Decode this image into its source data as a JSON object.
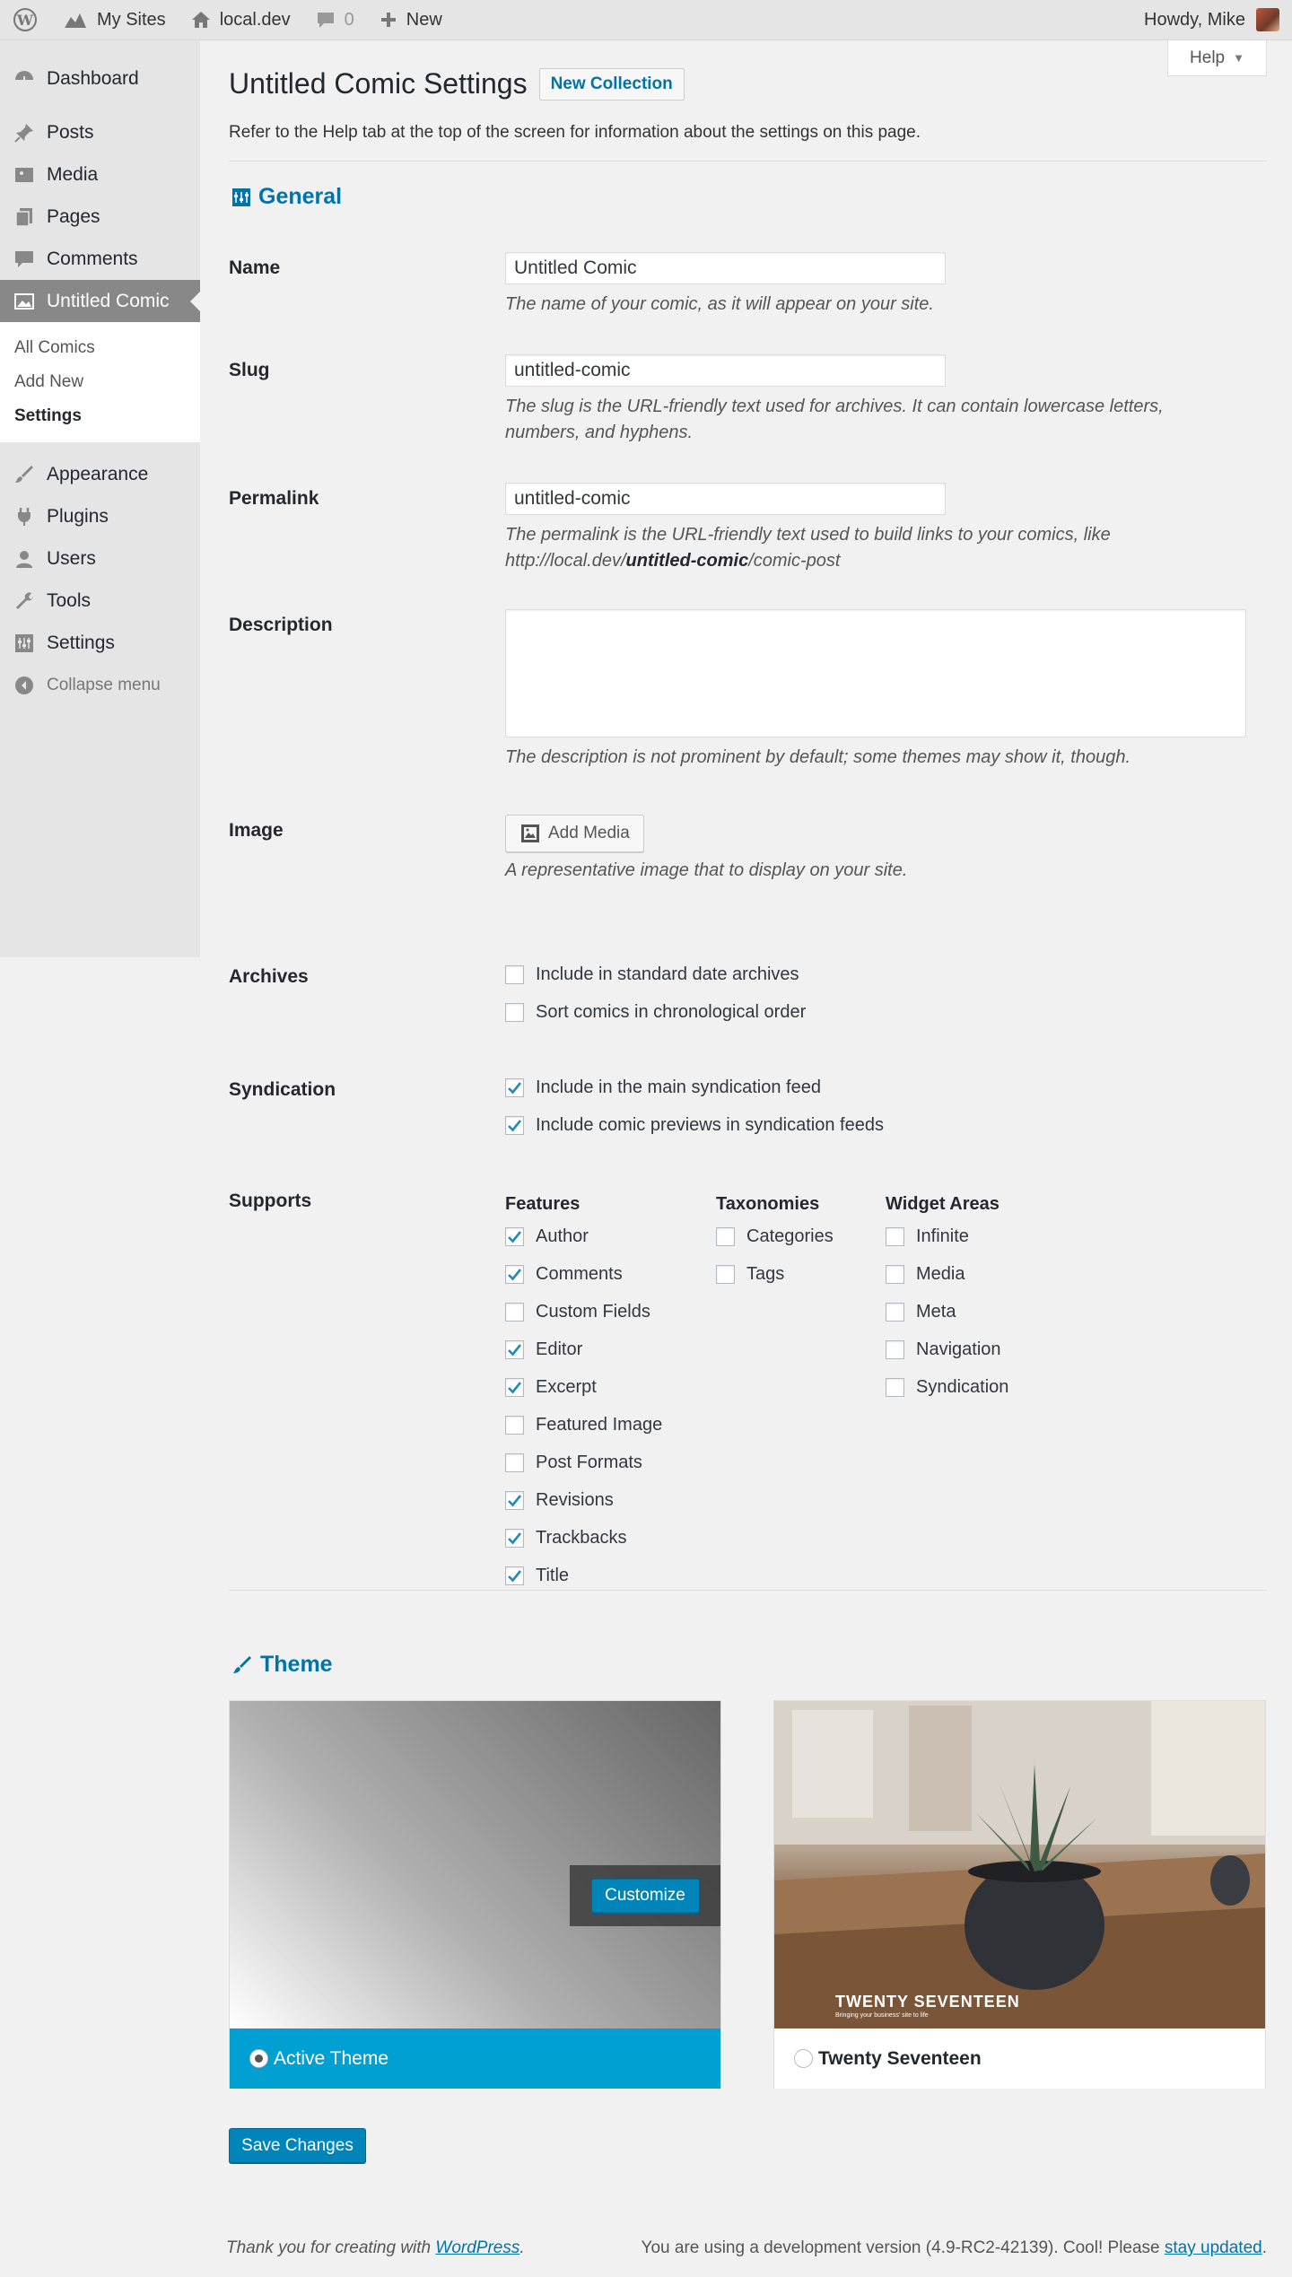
{
  "adminbar": {
    "my_sites": "My Sites",
    "site": "local.dev",
    "comments_count": "0",
    "new": "New",
    "howdy": "Howdy, Mike"
  },
  "sidebar": {
    "items": [
      {
        "label": "Dashboard",
        "icon": "dashboard-icon"
      },
      {
        "label": "Posts",
        "icon": "pin-icon"
      },
      {
        "label": "Media",
        "icon": "media-icon"
      },
      {
        "label": "Pages",
        "icon": "pages-icon"
      },
      {
        "label": "Comments",
        "icon": "comment-icon"
      },
      {
        "label": "Untitled Comic",
        "icon": "comic-icon"
      }
    ],
    "submenu": [
      "All Comics",
      "Add New",
      "Settings"
    ],
    "items_lower": [
      {
        "label": "Appearance",
        "icon": "brush-icon"
      },
      {
        "label": "Plugins",
        "icon": "plug-icon"
      },
      {
        "label": "Users",
        "icon": "user-icon"
      },
      {
        "label": "Tools",
        "icon": "wrench-icon"
      },
      {
        "label": "Settings",
        "icon": "settings-icon"
      }
    ],
    "collapse": "Collapse menu"
  },
  "page": {
    "help": "Help",
    "title": "Untitled Comic Settings",
    "new_collection": "New Collection",
    "intro": "Refer to the Help tab at the top of the screen for information about the settings on this page."
  },
  "general": {
    "title": "General",
    "name_label": "Name",
    "name_value": "Untitled Comic",
    "name_desc": "The name of your comic, as it will appear on your site.",
    "slug_label": "Slug",
    "slug_value": "untitled-comic",
    "slug_desc": "The slug is the URL-friendly text used for archives. It can contain lowercase letters, numbers, and hyphens.",
    "permalink_label": "Permalink",
    "permalink_value": "untitled-comic",
    "permalink_desc_a": "The permalink is the URL-friendly text used to build links to your comics, like http://local.dev/",
    "permalink_desc_b": "untitled-comic",
    "permalink_desc_c": "/comic-post",
    "description_label": "Description",
    "description_desc": "The description is not prominent by default; some themes may show it, though.",
    "image_label": "Image",
    "add_media": "Add Media",
    "image_desc": "A representative image that to display on your site.",
    "archives_label": "Archives",
    "archives": [
      {
        "label": "Include in standard date archives",
        "checked": false
      },
      {
        "label": "Sort comics in chronological order",
        "checked": false
      }
    ],
    "syndication_label": "Syndication",
    "syndication": [
      {
        "label": "Include in the main syndication feed",
        "checked": true
      },
      {
        "label": "Include comic previews in syndication feeds",
        "checked": true
      }
    ],
    "supports_label": "Supports",
    "features_head": "Features",
    "features": [
      {
        "label": "Author",
        "checked": true
      },
      {
        "label": "Comments",
        "checked": true
      },
      {
        "label": "Custom Fields",
        "checked": false
      },
      {
        "label": "Editor",
        "checked": true
      },
      {
        "label": "Excerpt",
        "checked": true
      },
      {
        "label": "Featured Image",
        "checked": false
      },
      {
        "label": "Post Formats",
        "checked": false
      },
      {
        "label": "Revisions",
        "checked": true
      },
      {
        "label": "Trackbacks",
        "checked": true
      },
      {
        "label": "Title",
        "checked": true
      }
    ],
    "taxonomies_head": "Taxonomies",
    "taxonomies": [
      {
        "label": "Categories",
        "checked": false
      },
      {
        "label": "Tags",
        "checked": false
      }
    ],
    "widgets_head": "Widget Areas",
    "widgets": [
      {
        "label": "Infinite",
        "checked": false
      },
      {
        "label": "Media",
        "checked": false
      },
      {
        "label": "Meta",
        "checked": false
      },
      {
        "label": "Navigation",
        "checked": false
      },
      {
        "label": "Syndication",
        "checked": false
      }
    ]
  },
  "theme": {
    "title": "Theme",
    "customize": "Customize",
    "active": "Active Theme",
    "other": "Twenty Seventeen",
    "other_logo": "TWENTY SEVENTEEN",
    "other_tagline": "Bringing your business' site to life"
  },
  "save": "Save Changes",
  "footer": {
    "thanks_a": "Thank you for creating with ",
    "thanks_link": "WordPress",
    "thanks_b": ".",
    "version_a": "You are using a development version (4.9-RC2-42139). Cool! Please ",
    "version_link": "stay updated",
    "version_b": "."
  }
}
